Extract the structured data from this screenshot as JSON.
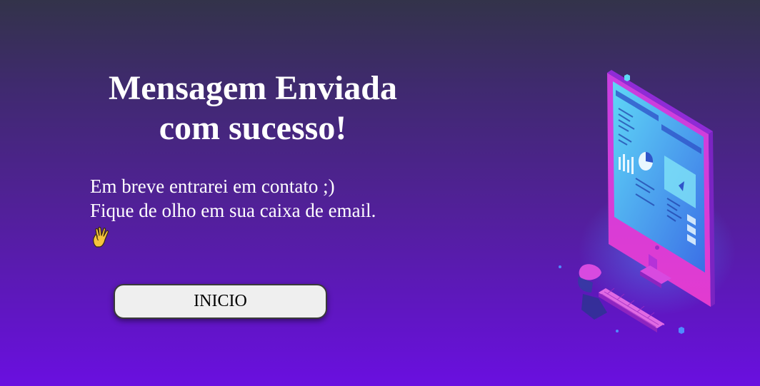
{
  "heading": {
    "line1": "Mensagem Enviada",
    "line2": "com sucesso!"
  },
  "message": {
    "line1": "Em breve entrarei em contato ;)",
    "line2": "Fique de olho em sua caixa de email."
  },
  "button": {
    "label": "INICIO"
  },
  "icons": {
    "wave": "vulcan-salute-icon",
    "illustration": "computer-monitor-illustration"
  },
  "colors": {
    "background_top": "#33334a",
    "background_bottom": "#6a0fe0",
    "button_bg": "#efefef",
    "accent_magenta": "#d63bd8",
    "accent_cyan": "#4fd2f0"
  }
}
